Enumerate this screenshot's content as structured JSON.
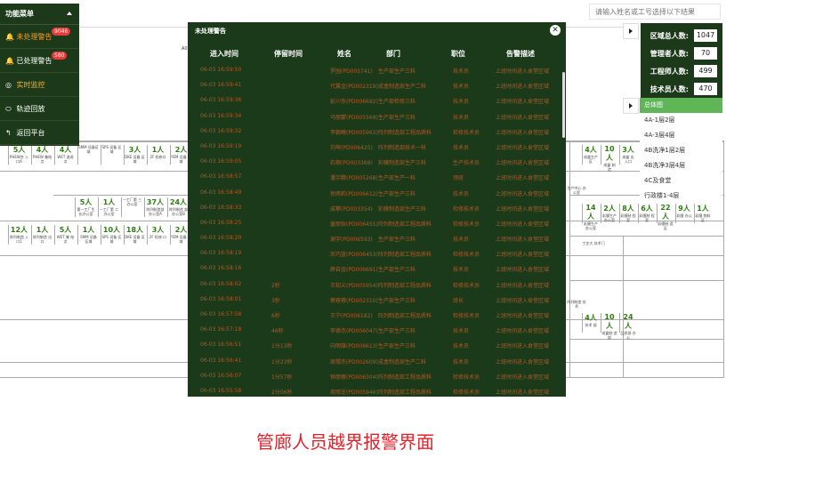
{
  "search": {
    "placeholder": "请输入姓名或工号选择以下结果"
  },
  "menu": {
    "title": "功能菜单",
    "items": [
      {
        "label": "未处理警告",
        "badge": "9046",
        "icon": "bell-icon",
        "glyph": "🔔"
      },
      {
        "label": "已处理警告",
        "badge": "580",
        "icon": "bell-icon",
        "glyph": "🔔"
      },
      {
        "label": "实时监控",
        "badge": "",
        "icon": "monitor-icon",
        "glyph": "◎"
      },
      {
        "label": "轨迹回放",
        "badge": "",
        "icon": "track-icon",
        "glyph": "⬭"
      },
      {
        "label": "返回平台",
        "badge": "",
        "icon": "return-icon",
        "glyph": "↰"
      }
    ]
  },
  "plan": {
    "subplan_title": "A0",
    "row1": [
      {
        "n": "5人",
        "t": "PHEW合 入口A"
      },
      {
        "n": "4人",
        "t": "PHEW 集结点"
      },
      {
        "n": "4人",
        "t": "WET 退进 点"
      },
      {
        "n": "",
        "t": "SMM 设备区域"
      },
      {
        "n": "",
        "t": "SPS 设备 区域"
      },
      {
        "n": "3人",
        "t": "DKE 设备 区域"
      },
      {
        "n": "1人",
        "t": "2F 检修口"
      },
      {
        "n": "2人",
        "t": "YEM 设备 区域"
      }
    ],
    "row2": [
      {
        "n": "5人",
        "t": "第一工厂生 长办公室"
      },
      {
        "n": "1人",
        "t": "一工厂第 二办公室"
      },
      {
        "n": "",
        "t": "一工厂第 三办公室"
      },
      {
        "n": "37人",
        "t": "阵列制造部 办公室A"
      },
      {
        "n": "24人",
        "t": "阵列制造 部办公室B"
      }
    ],
    "row3": [
      {
        "n": "12人",
        "t": "阵列制造 入口1"
      },
      {
        "n": "1人",
        "t": "阵列制造 出口"
      },
      {
        "n": "5人",
        "t": "WET 集 结点"
      },
      {
        "n": "1人",
        "t": "SMM 设备 区域"
      },
      {
        "n": "10人",
        "t": "SPS 设备 区域"
      },
      {
        "n": "18人",
        "t": "DKE 设备 区域"
      },
      {
        "n": "3人",
        "t": "2F 检修 口"
      },
      {
        "n": "2人",
        "t": "YEM 设备 区域"
      }
    ],
    "right_row1": [
      {
        "n": "4人",
        "t": "成盒生产 区"
      },
      {
        "n": "10人",
        "t": "成盒 制 造"
      },
      {
        "n": "3人",
        "t": "成盒 出 入口"
      }
    ],
    "right_row2": [
      {
        "n": "14人",
        "t": "彩膜生产 办公室"
      },
      {
        "n": "2人",
        "t": "彩膜生产 办公室"
      },
      {
        "n": "8人",
        "t": "彩膜制 程室"
      },
      {
        "n": "6人",
        "t": "彩膜制 程室"
      },
      {
        "n": "22人",
        "t": "彩膜制 造区"
      },
      {
        "n": "9人",
        "t": "彩膜 办公"
      },
      {
        "n": "1人",
        "t": "彩膜 物料区"
      }
    ],
    "right_row3": [
      {
        "n": "4人",
        "t": "技术 部"
      },
      {
        "n": "10人",
        "t": "成盒制 造部"
      },
      {
        "n": "24人",
        "t": "品质部 办公"
      }
    ],
    "misc_labels": [
      "工艺大 技术门",
      "生产中心 办公室",
      "阵列制造 技术"
    ]
  },
  "stats": [
    {
      "label": "区域总人数:",
      "value": "1047"
    },
    {
      "label": "管理者人数:",
      "value": "70"
    },
    {
      "label": "工程师人数:",
      "value": "499"
    },
    {
      "label": "技术员人数:",
      "value": "470"
    }
  ],
  "floors": [
    "总体图",
    "4A-1层2层",
    "4A-3层4层",
    "4B洗净1层2层",
    "4B洗净3层4层",
    "4C及食堂",
    "行政楼1-4层"
  ],
  "modal": {
    "title": "未处理警告",
    "columns": [
      "进入时间",
      "停留时间",
      "姓名",
      "部门",
      "职位",
      "告警描述"
    ],
    "rows": [
      [
        "06-03 16:59:50",
        "",
        "罗园(PD005741)",
        "生产部生产三科",
        "技术员",
        "上班时间进入食堂区域"
      ],
      [
        "06-03 16:59:41",
        "",
        "代翼金(PD002319)",
        "成盒制造部生产二科",
        "技术员",
        "上班时间进入食堂区域"
      ],
      [
        "06-03 16:59:36",
        "",
        "彭川东(PD006692)",
        "生产部检修三科",
        "技术员",
        "上班时间进入食堂区域"
      ],
      [
        "06-03 16:59:34",
        "",
        "马丽蒙(PD005569)",
        "生产部生产三科",
        "技术员",
        "上班时间进入食堂区域"
      ],
      [
        "06-03 16:59:32",
        "",
        "李朝曦(PD005963)",
        "阵列制造部工程品质科",
        "检修技术员",
        "上班时间进入食堂区域"
      ],
      [
        "06-03 16:59:19",
        "",
        "刘坤(PD006425)",
        "阵列制造部技术一科",
        "技术员",
        "上班时间进入食堂区域"
      ],
      [
        "06-03 16:59:05",
        "",
        "石楠(PD003369)",
        "彩膜制造部生产三科",
        "生产技术员",
        "上班时间进入食堂区域"
      ],
      [
        "06-03 16:58:57",
        "",
        "潘宇腾(PD005268)",
        "生产部生产一科",
        "领班",
        "上班时间进入食堂区域"
      ],
      [
        "06-03 16:58:49",
        "",
        "徐雨莉(PD006612)",
        "生产部生产三科",
        "技术员",
        "上班时间进入食堂区域"
      ],
      [
        "06-03 16:58:33",
        "",
        "成攀(PD003354)",
        "彩膜制造部生产三科",
        "检修技术员",
        "上班时间进入食堂区域"
      ],
      [
        "06-03 16:58:25",
        "",
        "童丽怡(PD006455)",
        "阵列制造部工程品质科",
        "检修技术员",
        "上班时间进入食堂区域"
      ],
      [
        "06-03 16:58:20",
        "",
        "谢宇(PD006593)",
        "生产部生产三科",
        "技术员",
        "上班时间进入食堂区域"
      ],
      [
        "06-03 16:58:19",
        "",
        "邓巧蓝(PD006453)",
        "阵列制造部工程品质科",
        "检修技术员",
        "上班时间进入食堂区域"
      ],
      [
        "06-03 16:58:16",
        "",
        "薛自金(PD006691)",
        "生产部生产三科",
        "技术员",
        "上班时间进入食堂区域"
      ],
      [
        "06-03 16:58:02",
        "2秒",
        "王知义(PD005954)",
        "阵列制造部工程品质科",
        "检修技术员",
        "上班时间进入食堂区域"
      ],
      [
        "06-03 16:58:01",
        "3秒",
        "蔡蓉蓉(PD002310)",
        "生产部生产三科",
        "班长",
        "上班时间进入食堂区域"
      ],
      [
        "06-03 16:57:58",
        "6秒",
        "王宁(PD006182)",
        "阵列制造部工程品质科",
        "检修技术员",
        "上班时间进入食堂区域"
      ],
      [
        "06-03 16:57:18",
        "46秒",
        "李德杰(PD006047)",
        "生产部生产三科",
        "技术员",
        "上班时间进入食堂区域"
      ],
      [
        "06-03 16:56:51",
        "1分13秒",
        "向明雄(PD006613)",
        "生产部生产三科",
        "技术员",
        "上班时间进入食堂区域"
      ],
      [
        "06-03 16:56:41",
        "1分23秒",
        "周锡杰(PD002609)",
        "成盒制造部生产二科",
        "技术员",
        "上班时间进入食堂区域"
      ],
      [
        "06-03 16:56:07",
        "1分57秒",
        "钟丽蓉(PD006304)",
        "阵列制造部工程品质科",
        "检修技术员",
        "上班时间进入食堂区域"
      ],
      [
        "06-03 16:55:58",
        "2分06秒",
        "周丽芝(PD005946)",
        "阵列制造部工程品质科",
        "检修技术员",
        "上班时间进入食堂区域"
      ]
    ]
  },
  "caption": "管廊人员越界报警界面",
  "colors": {
    "panel": "#1b3a19",
    "row_text": "#b25a2a",
    "accent": "#5fb657",
    "caption": "#e8202a"
  }
}
